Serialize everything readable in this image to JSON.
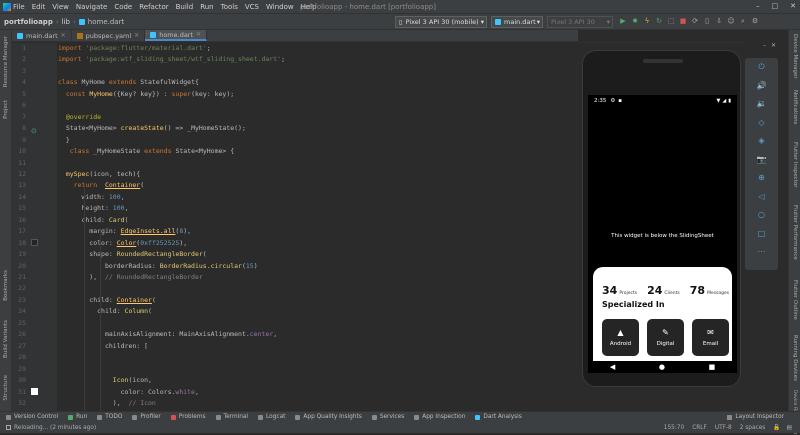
{
  "menubar": {
    "items": [
      "File",
      "Edit",
      "View",
      "Navigate",
      "Code",
      "Refactor",
      "Build",
      "Run",
      "Tools",
      "VCS",
      "Window",
      "Help"
    ],
    "window_title": "portfolioapp - home.dart [portfolioapp]",
    "controls": [
      "–",
      "□",
      "✕"
    ]
  },
  "navbar": {
    "project": "portfolioapp",
    "folder": "lib",
    "file": "home.dart",
    "device": "Pixel 3 API 30 (mobile)",
    "main_config": "main.dart",
    "avd": "Pixel 3 API 30"
  },
  "tabs": [
    {
      "label": "main.dart"
    },
    {
      "label": "pubspec.yaml"
    },
    {
      "label": "home.dart"
    }
  ],
  "left_strip": [
    "Resource Manager",
    "Project",
    "Bookmarks",
    "Build Variants",
    "Structure"
  ],
  "right_strip": [
    "Device Manager",
    "Notifications",
    "Flutter Inspector",
    "Flutter Performance",
    "Flutter Outline",
    "Running Devices",
    "Device File Explorer"
  ],
  "code_lines": [
    {
      "n": "1",
      "html": "<span class='kw'>import</span> <span class='str'>'package:flutter/material.dart'</span>;"
    },
    {
      "n": "2",
      "html": "<span class='kw'>import</span> <span class='str'>'package:wtf_sliding_sheet/wtf_sliding_sheet.dart'</span>;"
    },
    {
      "n": "3",
      "html": ""
    },
    {
      "n": "4",
      "html": "<span class='kw'>class</span> MyHome <span class='kw'>extends</span> StatefulWidget{"
    },
    {
      "n": "5",
      "html": "  <span class='kw'>const</span> <span class='fn'>MyHome</span>({Key? key}) : <span class='kw'>super</span>(key: key);"
    },
    {
      "n": "6",
      "html": ""
    },
    {
      "n": "7",
      "html": "  <span class='ann'>@override</span>"
    },
    {
      "n": "8",
      "html": "  State&lt;MyHome&gt; <span class='fn'>createState</span>() =&gt; _MyHomeState();"
    },
    {
      "n": "9",
      "html": "  }"
    },
    {
      "n": "10",
      "html": "   <span class='kw'>class</span> _MyHomeState <span class='kw'>extends</span> State&lt;MyHome&gt; {"
    },
    {
      "n": "11",
      "html": ""
    },
    {
      "n": "12",
      "html": "  <span class='fn'>mySpec</span>(icon, tech){"
    },
    {
      "n": "13",
      "html": "    <span class='kw'>return</span>  <span class='und'>Container</span>("
    },
    {
      "n": "14",
      "html": "      width: <span class='num'>100</span>,"
    },
    {
      "n": "15",
      "html": "      height: <span class='num'>100</span>,"
    },
    {
      "n": "16",
      "html": "      child: <span class='typ'>Card</span>("
    },
    {
      "n": "17",
      "html": "        margin: <span class='und'>EdgeInsets.all</span>(<span class='num'>8</span>),"
    },
    {
      "n": "18",
      "html": "        color: <span class='und'>Color</span>(<span class='num'>0xff252525</span>),"
    },
    {
      "n": "19",
      "html": "        shape: <span class='typ'>RoundedRectangleBorder</span>("
    },
    {
      "n": "20",
      "html": "            borderRadius: <span class='typ'>BorderRadius.circular</span>(<span class='num'>15</span>)"
    },
    {
      "n": "21",
      "html": "        ),  <span class='cm'>// RoundedRectangleBorder</span>"
    },
    {
      "n": "22",
      "html": ""
    },
    {
      "n": "23",
      "html": "        child: <span class='und'>Container</span>("
    },
    {
      "n": "24",
      "html": "          child: <span class='typ'>Column</span>("
    },
    {
      "n": "25",
      "html": ""
    },
    {
      "n": "26",
      "html": "            mainAxisAlignment: MainAxisAlignment.<span class='prop'>center</span>,"
    },
    {
      "n": "27",
      "html": "            children: ["
    },
    {
      "n": "28",
      "html": ""
    },
    {
      "n": "29",
      "html": ""
    },
    {
      "n": "30",
      "html": "              <span class='typ'>Icon</span>(icon,"
    },
    {
      "n": "31",
      "html": "                color: Colors.<span class='prop'>white</span>,"
    },
    {
      "n": "32",
      "html": "              ),  <span class='cm'>// Icon</span>"
    }
  ],
  "emulator": {
    "time": "2:35",
    "body_text": "This widget is below the SlidingSheet",
    "stats": [
      {
        "num": "34",
        "label": "Projects"
      },
      {
        "num": "24",
        "label": "Clients"
      },
      {
        "num": "78",
        "label": "Messages"
      }
    ],
    "heading": "Specialized In",
    "cards": [
      {
        "icon": "▲",
        "label": "Android"
      },
      {
        "icon": "✎",
        "label": "Digital"
      },
      {
        "icon": "✉",
        "label": "Email"
      }
    ],
    "cards_row2_icons": [
      "▮",
      "▭",
      "✱"
    ]
  },
  "emu_tools": [
    "⏻",
    "🔊",
    "🔉",
    "◇",
    "◈",
    "📷",
    "⊕",
    "◁",
    "○",
    "□",
    "⋯"
  ],
  "bottom_tools": [
    {
      "label": "Version Control",
      "color": "#8a8a8a"
    },
    {
      "label": "Run",
      "color": "#59a869"
    },
    {
      "label": "TODO",
      "color": "#8a8a8a"
    },
    {
      "label": "Profiler",
      "color": "#8a8a8a"
    },
    {
      "label": "Problems",
      "color": "#d55252"
    },
    {
      "label": "Terminal",
      "color": "#8a8a8a"
    },
    {
      "label": "Logcat",
      "color": "#8a8a8a"
    },
    {
      "label": "App Quality Insights",
      "color": "#8a8a8a"
    },
    {
      "label": "Services",
      "color": "#8a8a8a"
    },
    {
      "label": "App Inspection",
      "color": "#8a8a8a"
    },
    {
      "label": "Dart Analysis",
      "color": "#40c4ff"
    }
  ],
  "layout_inspector": "Layout Inspector",
  "status": {
    "message": "Reloading... (2 minutes ago)",
    "position": "155:70",
    "line_sep": "CRLF",
    "encoding": "UTF-8",
    "indent": "2 spaces"
  }
}
